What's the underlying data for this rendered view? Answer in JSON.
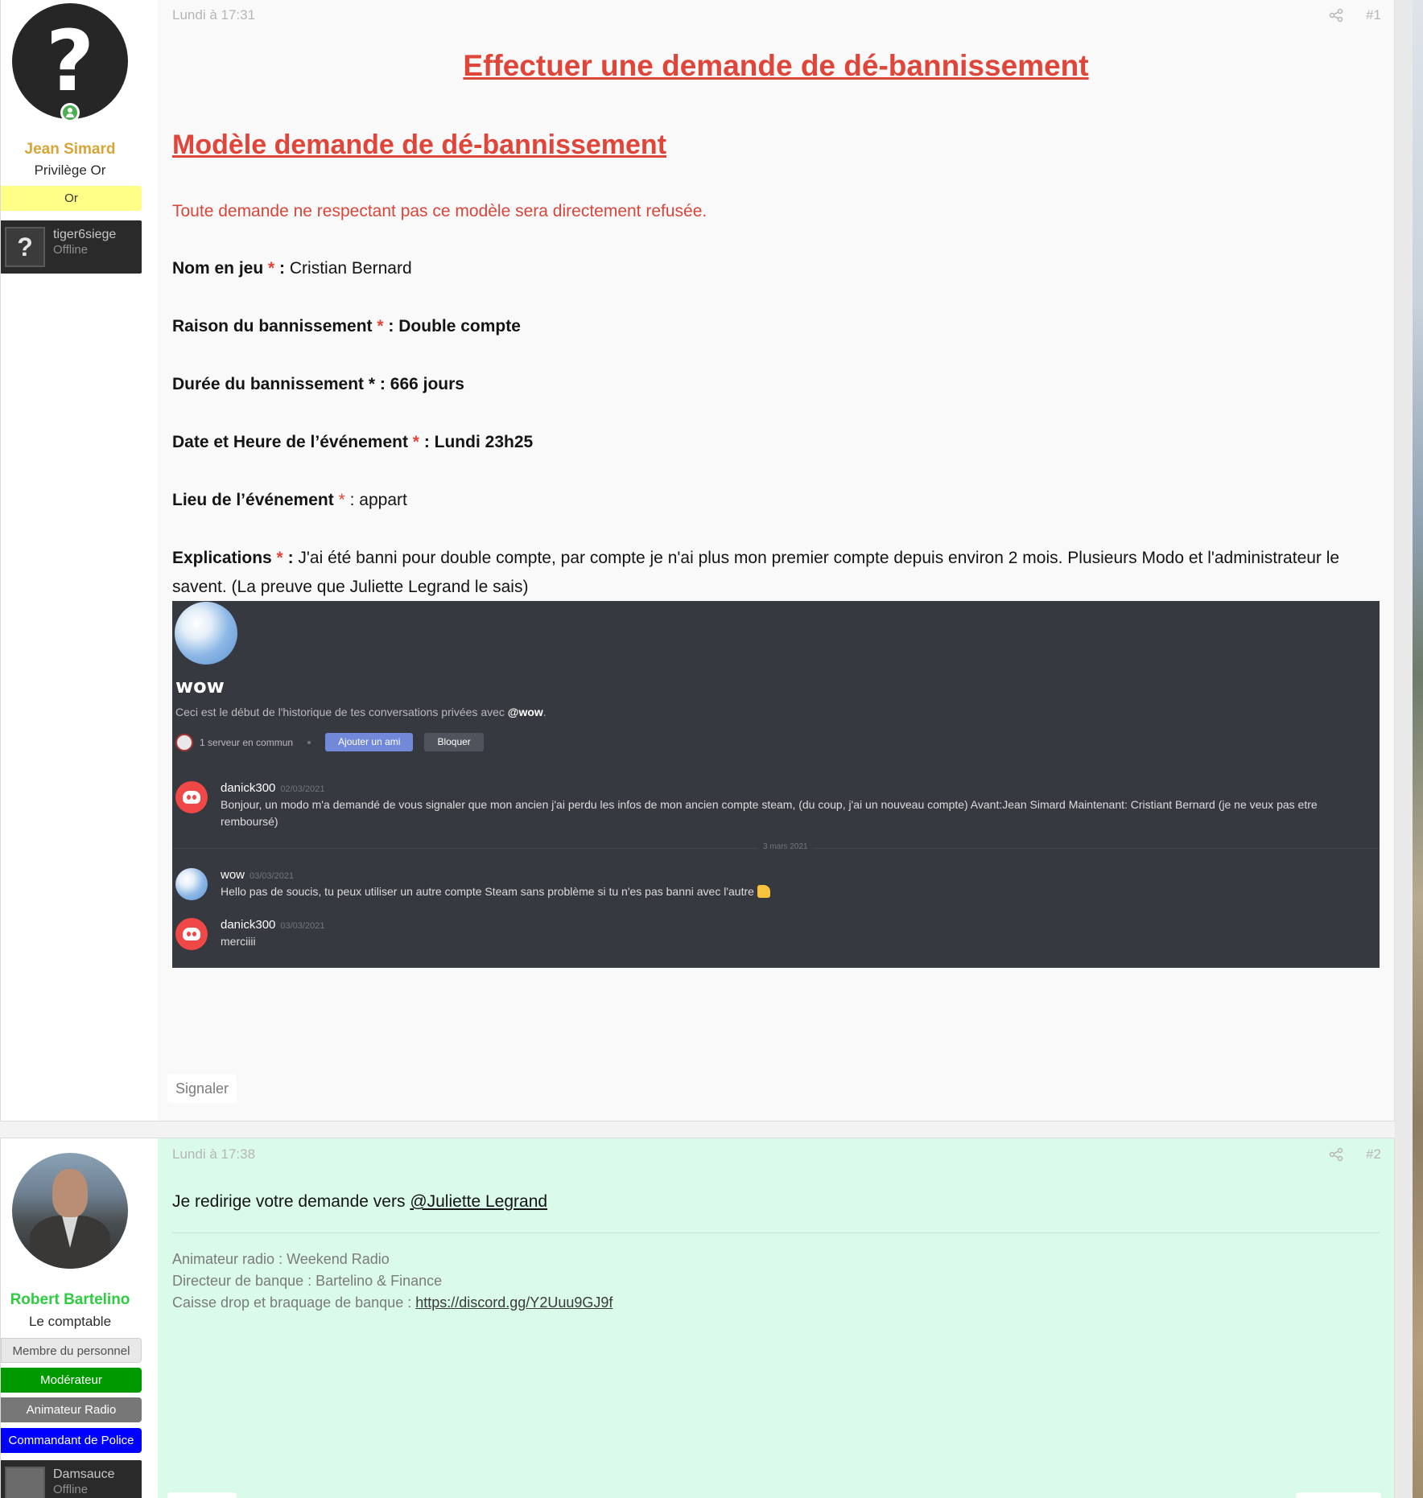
{
  "post1": {
    "user": {
      "avatar_glyph": "?",
      "name": "Jean Simard",
      "name_color": "#d8a536",
      "title": "Privilège Or",
      "banner": {
        "label": "Or",
        "bg": "#ffff88",
        "color": "#333333"
      },
      "steam": {
        "avatar_glyph": "?",
        "name": "tiger6siege",
        "status": "Offline"
      }
    },
    "date": "Lundi à 17:31",
    "number": "#1",
    "heading": "Effectuer une demande de dé-bannissement",
    "subheading": "Modèle demande de dé-bannissement",
    "notice": "Toute demande ne respectant pas ce modèle sera directement refusée.",
    "fields": {
      "nom": {
        "label": "Nom en jeu",
        "star": "*",
        "sep": " : ",
        "value": "Cristian Bernard"
      },
      "raison": {
        "label": "Raison du bannissement",
        "star": "*",
        "sep": " : ",
        "value": "Double compte"
      },
      "duree": {
        "label": "Durée du bannissement",
        "star": "*",
        "sep": " : ",
        "value": "666 jours"
      },
      "date": {
        "label": "Date et Heure de l’événement",
        "star": "*",
        "sep": " : ",
        "value": "Lundi 23h25"
      },
      "lieu": {
        "label": "Lieu de l’événement",
        "star": "*",
        "sep": " : ",
        "value": "appart"
      },
      "explications": {
        "label": "Explications",
        "star": "*",
        "sep": " : ",
        "value": "J'ai été banni pour double compte, par compte je n'ai plus mon premier compte depuis environ 2 mois. Plusieurs Modo et l'administrateur le savent. (La preuve que Juliette Legrand le sais)"
      }
    },
    "discord": {
      "title": "wow",
      "intro_prefix": "Ceci est le début de l'historique de tes conversations privées avec ",
      "intro_user": "@wow",
      "intro_suffix": ".",
      "common": "1 serveur en commun",
      "add_friend": "Ajouter un ami",
      "block": "Bloquer",
      "date_divider": "3 mars 2021",
      "messages": [
        {
          "author": "danick300",
          "time": "02/03/2021",
          "text": "Bonjour, un modo m'a demandé de vous signaler que mon ancien j'ai perdu les infos de mon ancien compte steam, (du coup, j'ai un nouveau compte) Avant:Jean Simard Maintenant: Cristiant Bernard (je ne veux pas etre remboursé)"
        },
        {
          "author": "wow",
          "time": "03/03/2021",
          "text": "Hello pas de soucis, tu peux utiliser un autre compte Steam sans problème si tu n'es pas banni avec l'autre"
        },
        {
          "author": "danick300",
          "time": "03/03/2021",
          "text": "merciiii"
        }
      ]
    },
    "report_label": "Signaler"
  },
  "post2": {
    "user": {
      "name": "Robert Bartelino",
      "name_color": "#2ecc40",
      "title": "Le comptable",
      "banners": [
        {
          "label": "Membre du personnel",
          "bg": "#e8e8e8",
          "color": "#505050"
        },
        {
          "label": "Modérateur",
          "bg": "#009900",
          "color": "#ffffff"
        },
        {
          "label": "Animateur Radio",
          "bg": "#777777",
          "color": "#ffffff"
        },
        {
          "label": "Commandant de Police",
          "bg": "#0000ff",
          "color": "#ffffff"
        }
      ],
      "steam": {
        "name": "Damsauce",
        "status": "Offline"
      }
    },
    "date": "Lundi à 17:38",
    "number": "#2",
    "message_prefix": "Je redirige votre demande vers ",
    "mention": "@Juliette Legrand",
    "signature": {
      "line1": "Animateur radio : Weekend Radio",
      "line2": "Directeur de banque : Bartelino & Finance",
      "line3_prefix": "Caisse drop et braquage de banque : ",
      "line3_link": "https://discord.gg/Y2Uuu9GJ9f"
    }
  }
}
